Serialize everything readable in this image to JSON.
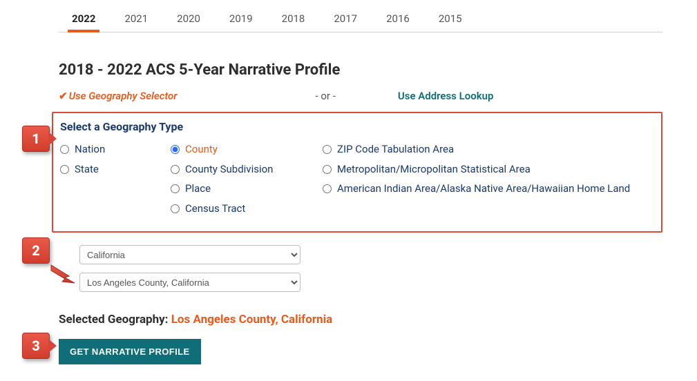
{
  "tabs": [
    "2022",
    "2021",
    "2020",
    "2019",
    "2018",
    "2017",
    "2016",
    "2015"
  ],
  "active_tab": "2022",
  "page_title": "2018 - 2022 ACS 5-Year Narrative Profile",
  "method": {
    "geo_selector_label": "Use Geography Selector",
    "or_label": "- or -",
    "address_lookup_label": "Use Address Lookup"
  },
  "geo_type": {
    "heading": "Select a Geography Type",
    "col1": [
      "Nation",
      "State"
    ],
    "col2": [
      "County",
      "County Subdivision",
      "Place",
      "Census Tract"
    ],
    "col3": [
      "ZIP Code Tabulation Area",
      "Metropolitan/Micropolitan Statistical Area",
      "American Indian Area/Alaska Native Area/Hawaiian Home Land"
    ],
    "selected": "County"
  },
  "dropdowns": {
    "state": "California",
    "county": "Los Angeles County, California"
  },
  "selected_geo": {
    "label": "Selected Geography: ",
    "value": "Los Angeles County, California"
  },
  "button_label": "GET NARRATIVE PROFILE",
  "steps": {
    "s1": "1",
    "s2": "2",
    "s3": "3"
  }
}
